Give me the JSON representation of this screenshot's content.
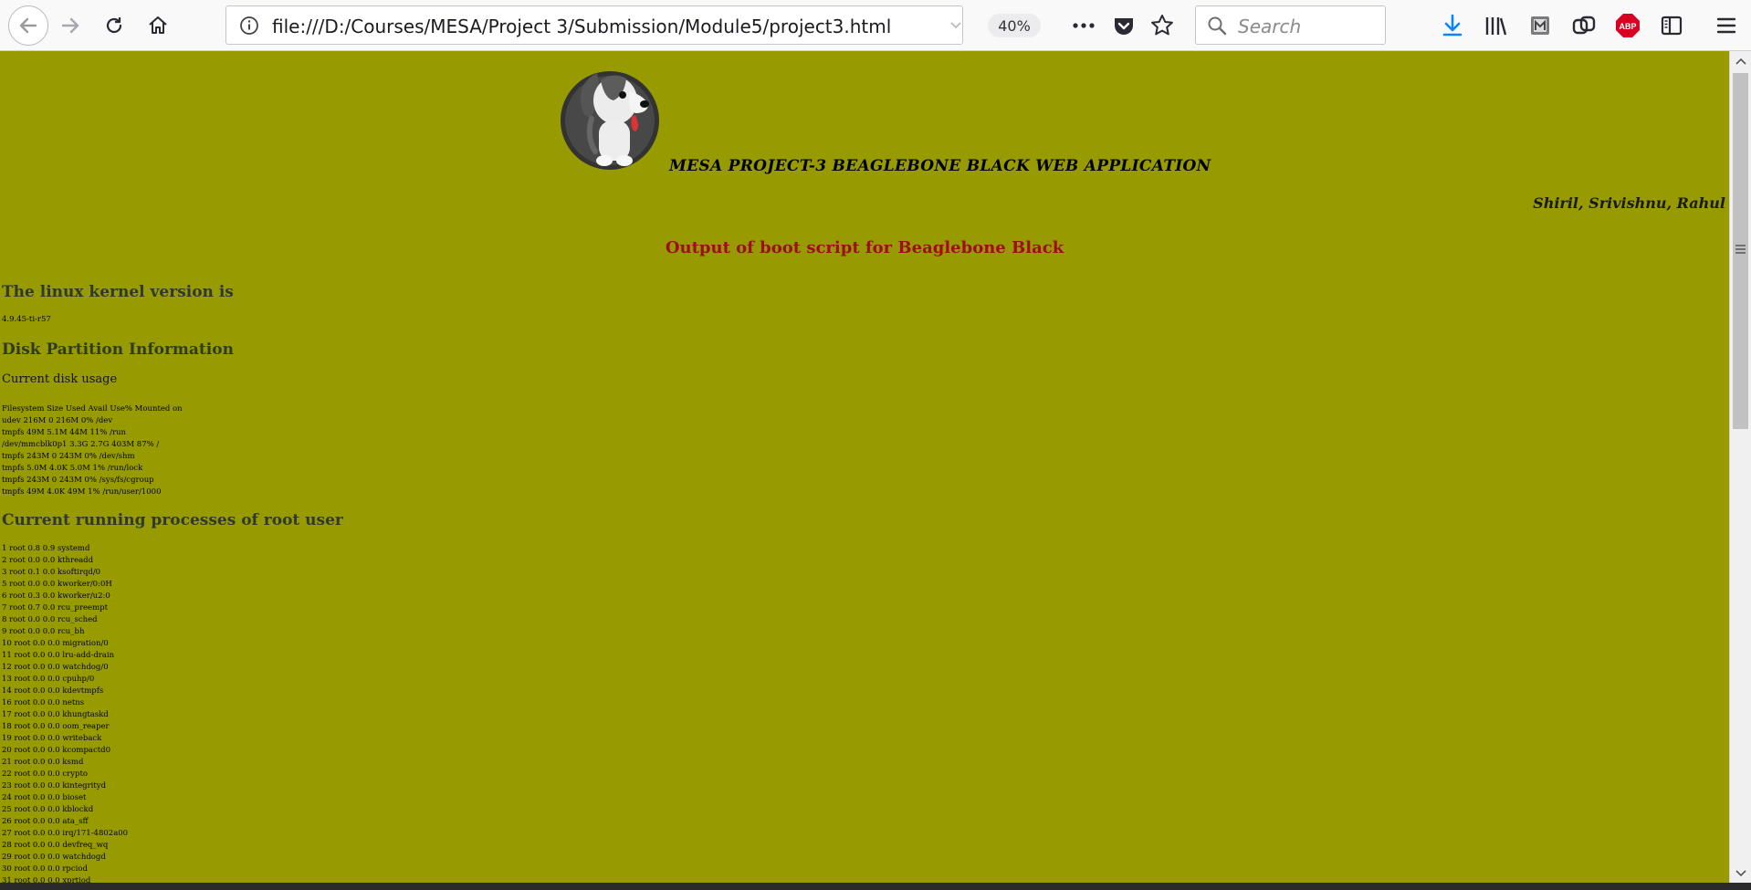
{
  "browser": {
    "url": "file:///D:/Courses/MESA/Project 3/Submission/Module5/project3.html",
    "zoom": "40%",
    "search_placeholder": "Search",
    "icons": [
      "back-icon",
      "forward-icon",
      "reload-icon",
      "home-icon",
      "info-icon",
      "dropdown-icon",
      "more-icon",
      "pocket-icon",
      "bookmark-star-icon",
      "search-icon",
      "download-icon",
      "library-icon",
      "extension-icon",
      "sync-icon",
      "adblock-icon",
      "sidebar-icon",
      "menu-icon"
    ],
    "adblock_label": "ABP",
    "colors": {
      "toolbar": "#f9f9fa",
      "download": "#0a84ff",
      "adblock": "#d70022"
    }
  },
  "page": {
    "background": "#979b00",
    "title": "MESA PROJECT-3 BEAGLEBONE BLACK WEB APPLICATION",
    "authors": "Shiril, Srivishnu, Rahul",
    "subtitle": "Output of boot script for Beaglebone Black",
    "subtitle_color": "#9b0f17",
    "kernel_heading": "The linux kernel version is",
    "kernel_version": "4.9.45-ti-r57",
    "disk_heading": "Disk Partition Information",
    "disk_sub": "Current disk usage",
    "disk_lines": [
      "Filesystem Size Used Avail Use% Mounted on",
      "udev 216M 0 216M 0% /dev",
      "tmpfs 49M 5.1M 44M 11% /run",
      "/dev/mmcblk0p1 3.3G 2.7G 403M 87% /",
      "tmpfs 243M 0 243M 0% /dev/shm",
      "tmpfs 5.0M 4.0K 5.0M 1% /run/lock",
      "tmpfs 243M 0 243M 0% /sys/fs/cgroup",
      "tmpfs 49M 4.0K 49M 1% /run/user/1000"
    ],
    "proc_heading": "Current running processes of root user",
    "proc_lines": [
      "1 root 0.8 0.9 systemd",
      "2 root 0.0 0.0 kthreadd",
      "3 root 0.1 0.0 ksoftirqd/0",
      "5 root 0.0 0.0 kworker/0:0H",
      "6 root 0.3 0.0 kworker/u2:0",
      "7 root 0.7 0.0 rcu_preempt",
      "8 root 0.0 0.0 rcu_sched",
      "9 root 0.0 0.0 rcu_bh",
      "10 root 0.0 0.0 migration/0",
      "11 root 0.0 0.0 lru-add-drain",
      "12 root 0.0 0.0 watchdog/0",
      "13 root 0.0 0.0 cpuhp/0",
      "14 root 0.0 0.0 kdevtmpfs",
      "16 root 0.0 0.0 netns",
      "17 root 0.0 0.0 khungtaskd",
      "18 root 0.0 0.0 oom_reaper",
      "19 root 0.0 0.0 writeback",
      "20 root 0.0 0.0 kcompactd0",
      "21 root 0.0 0.0 ksmd",
      "22 root 0.0 0.0 crypto",
      "23 root 0.0 0.0 kintegrityd",
      "24 root 0.0 0.0 bioset",
      "25 root 0.0 0.0 kblockd",
      "26 root 0.0 0.0 ata_sff",
      "27 root 0.0 0.0 irq/171-4802a00",
      "28 root 0.0 0.0 devfreq_wq",
      "29 root 0.0 0.0 watchdogd",
      "30 root 0.0 0.0 rpciod",
      "31 root 0.0 0.0 xprtiod"
    ]
  }
}
